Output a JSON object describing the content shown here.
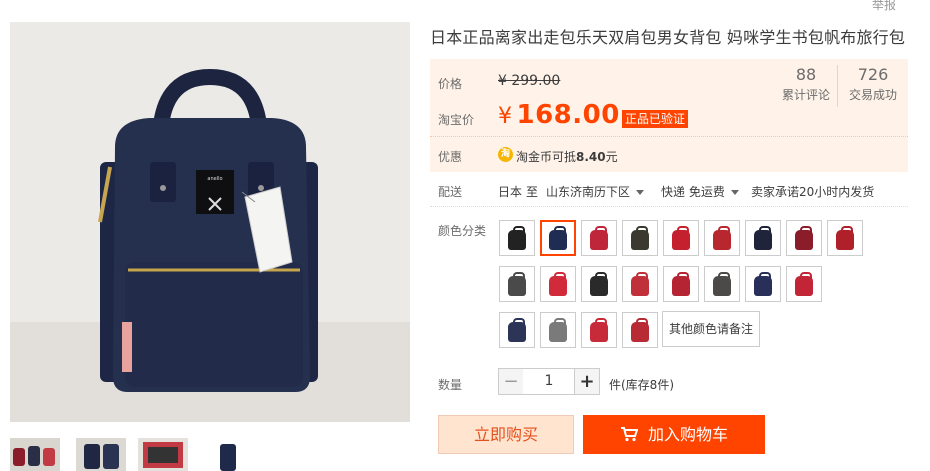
{
  "top": {
    "report_label": "举报"
  },
  "product": {
    "title": "日本正品离家出走包乐天双肩包男女背包 妈咪学生书包帆布旅行包"
  },
  "price": {
    "original_label": "价格",
    "original_value": "¥ 299.00",
    "taobao_label": "淘宝价",
    "currency": "¥",
    "taobao_value": "168.00",
    "verified_badge": "正品已验证",
    "reviews_count": "88",
    "reviews_label": "累计评论",
    "sales_count": "726",
    "sales_label": "交易成功"
  },
  "promo": {
    "label": "优惠",
    "coin_icon": "淘",
    "text_prefix": "淘金币可抵",
    "text_amount": "8.40",
    "text_suffix": "元"
  },
  "shipping": {
    "label": "配送",
    "from": "日本",
    "to_word": "至",
    "destination": "山东济南历下区",
    "method": "快递 免运费",
    "promise": "卖家承诺20小时内发货"
  },
  "colors": {
    "label": "颜色分类",
    "selected_index": 1,
    "swatches": [
      {
        "color": "#222222"
      },
      {
        "color": "#1f2d52"
      },
      {
        "color": "#c0263a"
      },
      {
        "color": "#3a3a30"
      },
      {
        "color": "#c5202e"
      },
      {
        "color": "#b8262e"
      },
      {
        "color": "#20243a"
      },
      {
        "color": "#8b1c2a"
      },
      {
        "color": "#b0202a"
      },
      {
        "color": "#4a4a4a"
      },
      {
        "color": "#d12a3a"
      },
      {
        "color": "#2a2a2a"
      },
      {
        "color": "#c0303a"
      },
      {
        "color": "#b52432"
      },
      {
        "color": "#4b4a48"
      },
      {
        "color": "#28305a"
      },
      {
        "color": "#c22636"
      },
      {
        "color": "#2c3558"
      },
      {
        "color": "#7a7a7a"
      },
      {
        "color": "#c72a38"
      },
      {
        "color": "#b82b35"
      }
    ],
    "other_label": "其他颜色请备注"
  },
  "quantity": {
    "label": "数量",
    "minus": "−",
    "value": "1",
    "plus": "+",
    "stock_text": "件(库存8件)"
  },
  "actions": {
    "buy_now": "立即购买",
    "add_cart": "加入购物车"
  },
  "gallery": {
    "brand_tag": "anello"
  }
}
